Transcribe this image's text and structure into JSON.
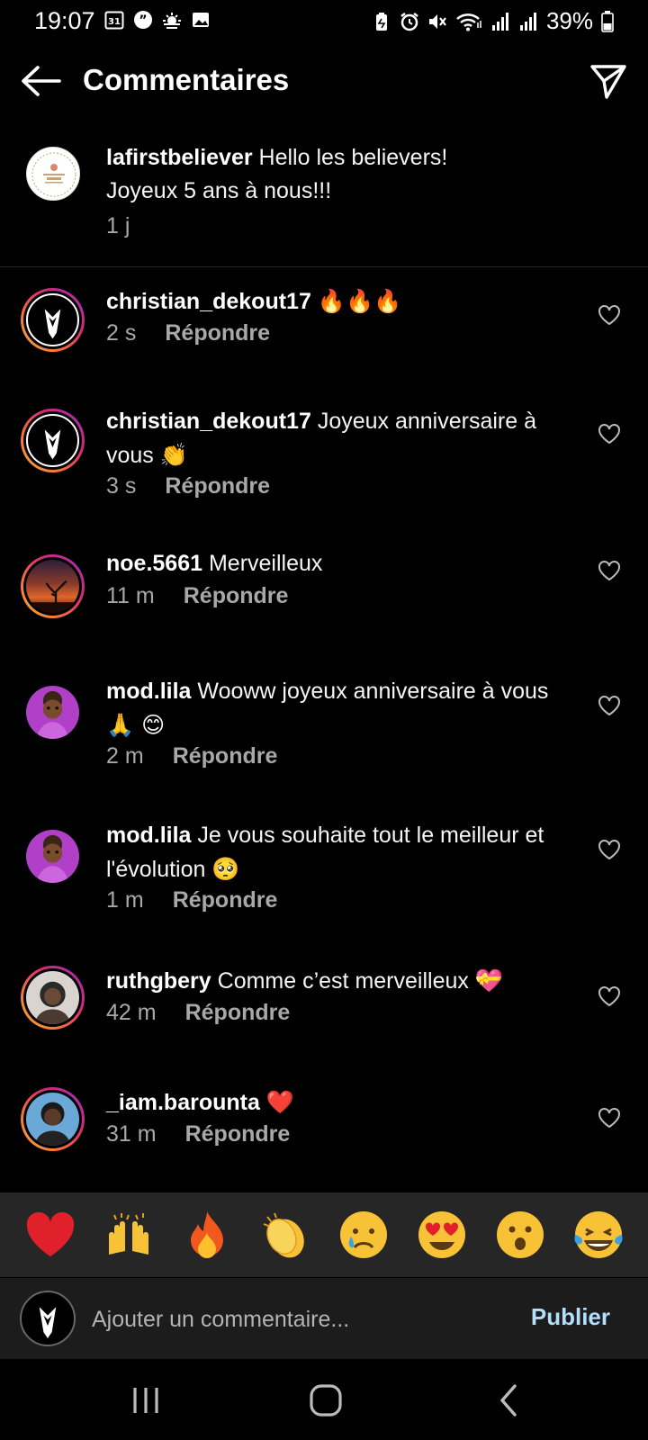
{
  "status_bar": {
    "time": "19:07",
    "calendar_day": "31",
    "battery": "39%",
    "left_icons": [
      "calendar-icon",
      "quote-icon",
      "weather-icon",
      "image-icon"
    ],
    "right_icons": [
      "battery-saver-icon",
      "alarm-icon",
      "mute-icon",
      "wifi-icon",
      "signal-icon",
      "signal-icon-2",
      "battery-icon"
    ]
  },
  "header": {
    "title": "Commentaires",
    "back_icon": "arrow-left-icon",
    "share_icon": "paper-plane-icon"
  },
  "caption": {
    "username": "lafirstbeliever",
    "text_line1": "Hello les believers!",
    "text_line2": "Joyeux 5 ans à nous!!!",
    "time": "1 j"
  },
  "comments": [
    {
      "username": "christian_dekout17",
      "text": "",
      "emoji": "🔥🔥🔥",
      "time": "2 s",
      "reply": "Répondre"
    },
    {
      "username": "christian_dekout17",
      "text": "Joyeux anniversaire à vous",
      "emoji": "👏",
      "time": "3 s",
      "reply": "Répondre"
    },
    {
      "username": "noe.5661",
      "text": "Merveilleux",
      "emoji": "",
      "time": "11 m",
      "reply": "Répondre"
    },
    {
      "username": "mod.lila",
      "text": "Wooww joyeux anniversaire à vous",
      "emoji": "🙏 😊",
      "time": "2 m",
      "reply": "Répondre"
    },
    {
      "username": "mod.lila",
      "text": "Je vous souhaite tout le meilleur et l'évolution",
      "emoji": "🥺",
      "time": "1 m",
      "reply": "Répondre"
    },
    {
      "username": "ruthgbery",
      "text": "Comme c’est merveilleux",
      "emoji": "💝",
      "time": "42 m",
      "reply": "Répondre"
    },
    {
      "username": "_iam.barounta",
      "text": "",
      "emoji": "❤️",
      "time": "31 m",
      "reply": "Répondre"
    }
  ],
  "quick_reactions": [
    "❤️",
    "🙌",
    "🔥",
    "👏",
    "😢",
    "😍",
    "😮",
    "😂"
  ],
  "input": {
    "placeholder": "Ajouter un commentaire...",
    "publish": "Publier"
  },
  "colors": {
    "background": "#000000",
    "secondary_text": "#a8a8a8",
    "publish": "#b2dffc",
    "emoji_bar": "#262626"
  }
}
